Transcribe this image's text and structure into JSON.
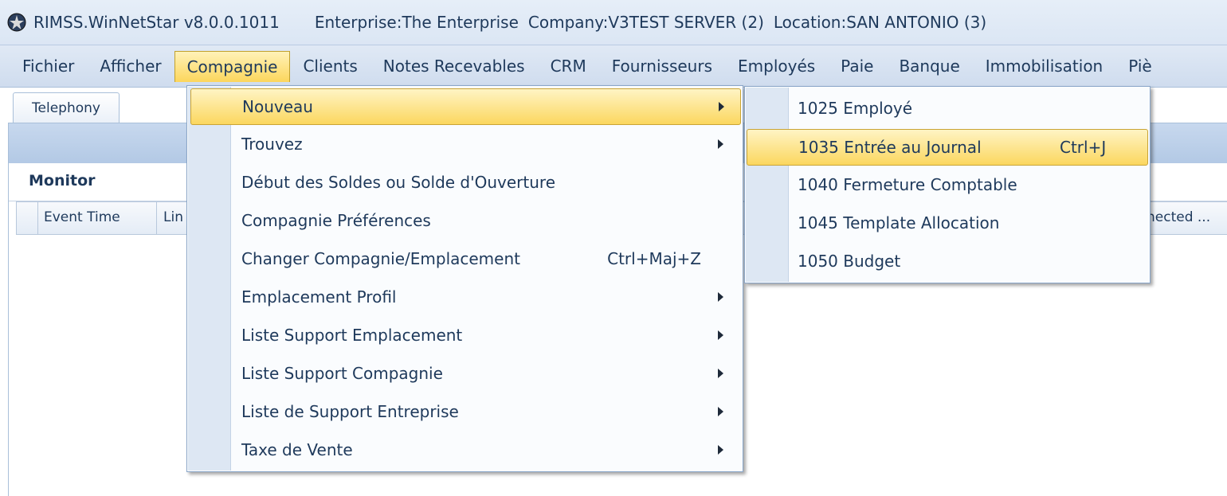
{
  "titlebar": {
    "app_name": "RIMSS.WinNetStar v8.0.0.1011",
    "enterprise": "Enterprise:The Enterprise",
    "company": "Company:V3TEST SERVER (2)",
    "location": "Location:SAN ANTONIO (3)"
  },
  "menubar": {
    "items": [
      "Fichier",
      "Afficher",
      "Compagnie",
      "Clients",
      "Notes Recevables",
      "CRM",
      "Fournisseurs",
      "Employés",
      "Paie",
      "Banque",
      "Immobilisation",
      "Piè"
    ],
    "active": "Compagnie"
  },
  "tabs": [
    "Telephony"
  ],
  "monitor": {
    "label": "Monitor",
    "columns": [
      "Event Time",
      "Lin",
      "nected ..."
    ]
  },
  "dropdown": {
    "items": [
      {
        "label": "Nouveau",
        "shortcut": "",
        "submenu": true
      },
      {
        "label": "Trouvez",
        "shortcut": "",
        "submenu": true
      },
      {
        "label": "Début des Soldes ou Solde d'Ouverture",
        "shortcut": "",
        "submenu": false
      },
      {
        "label": "Compagnie Préférences",
        "shortcut": "",
        "submenu": false
      },
      {
        "label": "Changer Compagnie/Emplacement",
        "shortcut": "Ctrl+Maj+Z",
        "submenu": false
      },
      {
        "label": "Emplacement Profil",
        "shortcut": "",
        "submenu": true
      },
      {
        "label": "Liste Support Emplacement",
        "shortcut": "",
        "submenu": true
      },
      {
        "label": "Liste Support Compagnie",
        "shortcut": "",
        "submenu": true
      },
      {
        "label": "Liste de Support Entreprise",
        "shortcut": "",
        "submenu": true
      },
      {
        "label": "Taxe de Vente",
        "shortcut": "",
        "submenu": true
      }
    ],
    "highlighted": "Nouveau"
  },
  "submenu": {
    "items": [
      {
        "label": "1025 Employé",
        "shortcut": ""
      },
      {
        "label": "1035 Entrée au Journal",
        "shortcut": "Ctrl+J"
      },
      {
        "label": "1040 Fermeture Comptable",
        "shortcut": ""
      },
      {
        "label": "1045 Template Allocation",
        "shortcut": ""
      },
      {
        "label": "1050 Budget",
        "shortcut": ""
      }
    ],
    "highlighted": "1035 Entrée au Journal"
  },
  "colors": {
    "highlight": "#fbd75f",
    "menubar": "#cfdcee",
    "text": "#1e395b"
  }
}
